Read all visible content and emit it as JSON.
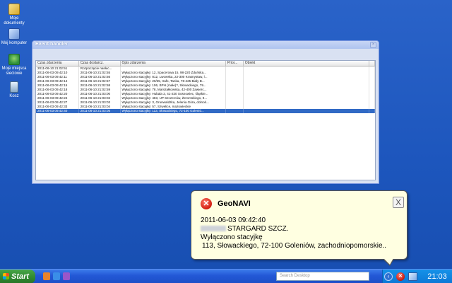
{
  "desktop": {
    "icons": [
      {
        "label": "Moje dokumenty"
      },
      {
        "label": "Mój komputer"
      },
      {
        "label": "Moje miejsca sieciowe"
      },
      {
        "label": "Kosz"
      }
    ]
  },
  "window": {
    "title": "Event handler",
    "columns": [
      "Czas zdarzenia",
      "Czas dostarcz.",
      "Opis zdarzenia",
      "Prior...",
      "Obiekt",
      ""
    ],
    "rows": [
      [
        "2011-06-10 21:02:51",
        "Rozpoczęcie nasłuc...",
        "",
        "",
        ""
      ],
      [
        "2011-06-03 09:42:10",
        "2011-06-10 21:02:55",
        "Wyłączono stacyjkę: 12, Spacerowa 15, 98-220 Zduńska...",
        "",
        ""
      ],
      [
        "2011-06-03 09:42:11",
        "2011-06-10 21:02:56",
        "Wyłączono stacyjkę: 812, Lwowska, 22-300 Krasnystaw, l...",
        "",
        ""
      ],
      [
        "2011-06-03 09:42:14",
        "2011-06-10 21:02:57",
        "Wyłączono stacyjkę: 20/25, trafo, Tanka, 78-425 Biały B...",
        "",
        ""
      ],
      [
        "2011-06-03 09:42:15",
        "2011-06-10 21:02:58",
        "Wyłączono stacyjkę: 106, BPH (małe)?, Słowackiego, 79...",
        "",
        ""
      ],
      [
        "2011-06-03 09:42:18",
        "2011-06-10 21:02:59",
        "Wyłączono stacyjkę: 78, Marszałkowska, 42-400 Zawierc...",
        "",
        ""
      ],
      [
        "2011-06-03 09:42:20",
        "2011-06-10 21:03:00",
        "Wyłączono stacyjkę: Hubala 2, 41-220 Sosnowiec, śląskie...",
        "",
        ""
      ],
      [
        "2011-06-03 09:42:24",
        "2011-06-10 21:03:02",
        "Wyłączono stacyjkę: 483, UP Szczerców, Żeromskiego, 9...",
        "",
        ""
      ],
      [
        "2011-06-03 09:42:27",
        "2011-06-10 21:03:03",
        "Wyłączono stacyjkę: 3, Grunwaldzka, Jelenia Góra, dolnoś...",
        "",
        ""
      ],
      [
        "2011-06-03 09:42:33",
        "2011-06-10 21:03:04",
        "Wyłączono stacyjkę: 57, Szwelice, mazowieckie",
        "",
        ""
      ],
      [
        "2011-06-03 09:42:40",
        "2011-06-10 21:03:05",
        "Wyłączono stacyjkę: 113, Słowackiego, 72-100 Golenió...",
        "",
        ""
      ]
    ],
    "selected_row": 10
  },
  "balloon": {
    "title": "GeoNAVI",
    "error_icon": "error-icon",
    "close_glyph": "X",
    "line1": "2011-06-03 09:42:40",
    "line2": "STARGARD SZCZ.",
    "line3": "Wyłączono stacyjkę",
    "line4": "113, Słowackiego, 72-100 Goleniów, zachodniopomorskie.."
  },
  "taskbar": {
    "start_label": "Start",
    "search_placeholder": "Search Desktop",
    "tray_chevron": "‹",
    "tray_geo_glyph": "✕",
    "clock": "21:03"
  }
}
